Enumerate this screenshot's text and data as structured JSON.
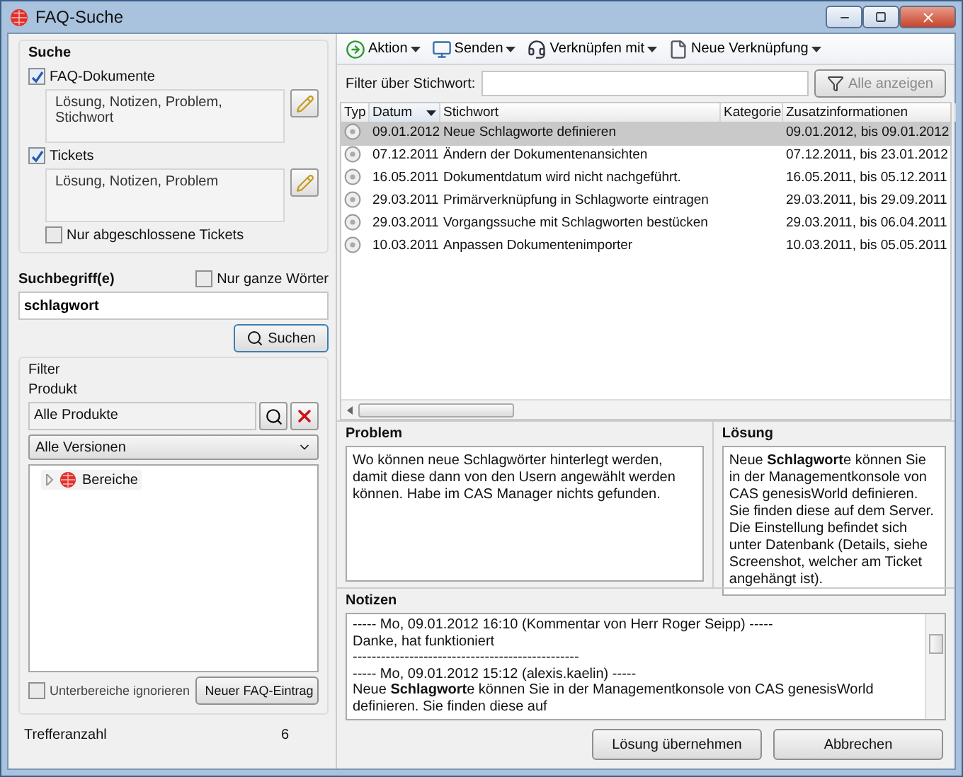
{
  "window": {
    "title": "FAQ-Suche"
  },
  "search": {
    "title": "Suche",
    "sources": [
      {
        "label": "FAQ-Dokumente",
        "checked": true,
        "fields": "Lösung, Notizen, Problem, Stichwort"
      },
      {
        "label": "Tickets",
        "checked": true,
        "fields": "Lösung, Notizen, Problem"
      }
    ],
    "closed_only": {
      "label": "Nur abgeschlossene Tickets",
      "checked": false
    }
  },
  "term": {
    "label": "Suchbegriff(e)",
    "whole_words": {
      "label": "Nur ganze Wörter",
      "checked": false
    },
    "value": "schlagwort",
    "button": "Suchen"
  },
  "filter": {
    "title": "Filter",
    "product_label": "Produkt",
    "product": "Alle Produkte",
    "version": "Alle Versionen",
    "tree": [
      {
        "label": "Bereiche",
        "expanded": false
      }
    ],
    "ignore_sub": {
      "label": "Unterbereiche ignorieren",
      "checked": false
    },
    "new_button": "Neuer FAQ-Eintrag"
  },
  "hits": {
    "label": "Trefferanzahl",
    "value": "6"
  },
  "toolbar": [
    {
      "label": "Aktion"
    },
    {
      "label": "Senden"
    },
    {
      "label": "Verknüpfen mit"
    },
    {
      "label": "Neue Verknüpfung"
    }
  ],
  "keyword_filter": {
    "label": "Filter über Stichwort:",
    "show_all": {
      "label": "Alle anzeigen",
      "disabled": true
    }
  },
  "table": {
    "columns": [
      {
        "label": "Typ",
        "sorted": false
      },
      {
        "label": "Datum",
        "sorted": true
      },
      {
        "label": "Stichwort",
        "sorted": false
      },
      {
        "label": "Kategorie",
        "sorted": false
      },
      {
        "label": "Zusatzinformationen",
        "sorted": false
      }
    ],
    "rows": [
      {
        "date": "09.01.2012",
        "keyword": "Neue Schlagworte definieren",
        "info": "09.01.2012, bis 09.01.2012",
        "selected": true
      },
      {
        "date": "07.12.2011",
        "keyword": "Ändern der Dokumentenansichten",
        "info": "07.12.2011, bis 23.01.2012",
        "selected": false
      },
      {
        "date": "16.05.2011",
        "keyword": "Dokumentdatum wird nicht nachgeführt.",
        "info": "16.05.2011, bis 05.12.2011",
        "selected": false
      },
      {
        "date": "29.03.2011",
        "keyword": "Primärverknüpfung in Schlagworte eintragen",
        "info": "29.03.2011, bis 29.09.2011",
        "selected": false
      },
      {
        "date": "29.03.2011",
        "keyword": "Vorgangssuche mit Schlagworten bestücken",
        "info": "29.03.2011, bis 06.04.2011",
        "selected": false
      },
      {
        "date": "10.03.2011",
        "keyword": "Anpassen Dokumentenimporter",
        "info": "10.03.2011, bis 05.05.2011",
        "selected": false
      }
    ]
  },
  "problem": {
    "title": "Problem",
    "text": "Wo können neue Schlagwörter hinterlegt werden, damit diese dann von den Usern angewählt werden können. Habe im CAS Manager nichts gefunden."
  },
  "solution": {
    "title": "Lösung",
    "text": "Neue **Schlagwort**e können Sie in der Managementkonsole von CAS genesisWorld definieren. Sie finden diese auf dem Server. Die Einstellung befindet sich unter Datenbank (Details, siehe Screenshot, welcher am Ticket angehängt ist)."
  },
  "notes": {
    "title": "Notizen",
    "lines": [
      "----- Mo, 09.01.2012 16:10 (Kommentar von Herr Roger Seipp) -----",
      "Danke, hat funktioniert",
      "------------------------------------------------",
      "----- Mo, 09.01.2012 15:12 (alexis.kaelin) -----",
      "Neue **Schlagwort**e können Sie in der Managementkonsole von CAS genesisWorld definieren. Sie finden diese auf"
    ]
  },
  "buttons": [
    "Lösung übernehmen",
    "Abbrechen"
  ]
}
